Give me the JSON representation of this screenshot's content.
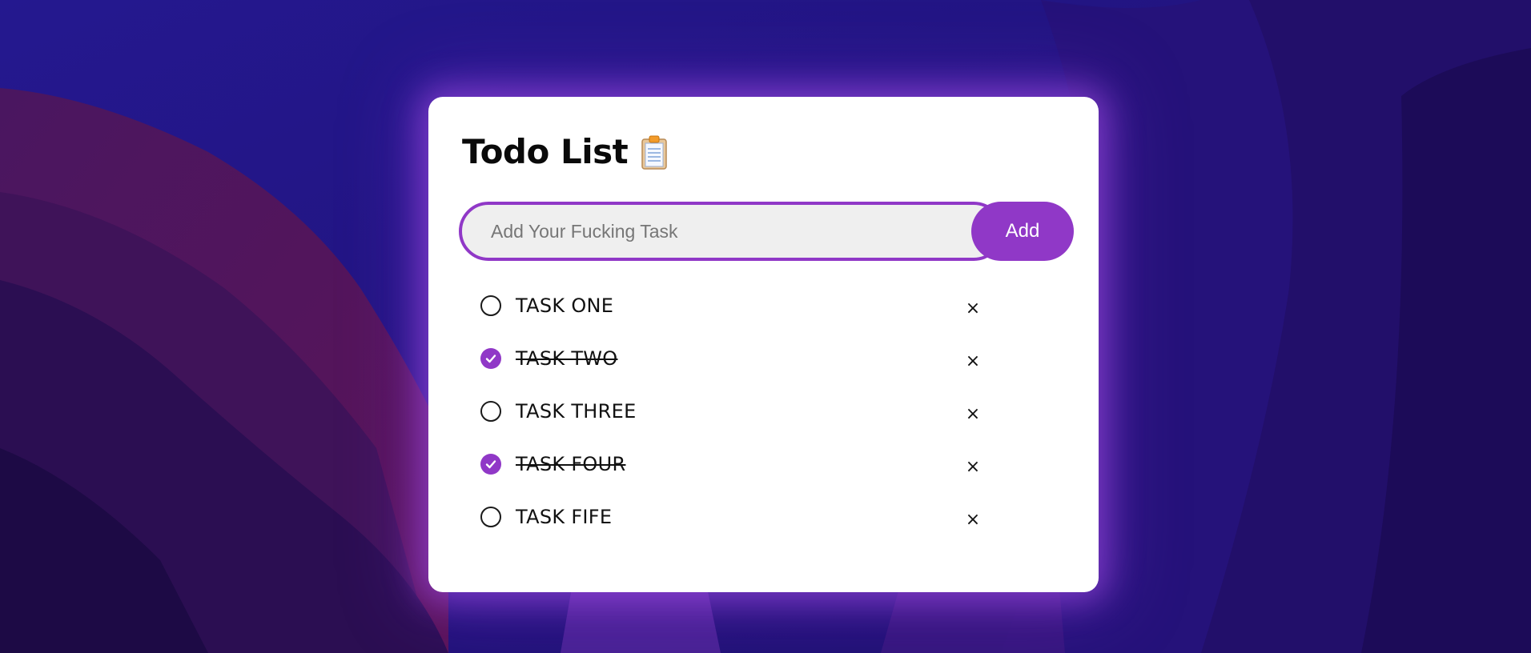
{
  "app": {
    "title": "Todo List",
    "title_icon": "clipboard-icon"
  },
  "form": {
    "placeholder": "Add Your Fucking Task",
    "add_label": "Add"
  },
  "tasks": [
    {
      "label": "TASK ONE",
      "done": false,
      "delete_label": "×"
    },
    {
      "label": "TASK TWO",
      "done": true,
      "delete_label": "×"
    },
    {
      "label": "TASK THREE",
      "done": false,
      "delete_label": "×"
    },
    {
      "label": "TASK FOUR",
      "done": true,
      "delete_label": "×"
    },
    {
      "label": "TASK FIFE",
      "done": false,
      "delete_label": "×"
    }
  ],
  "colors": {
    "accent": "#9038c7",
    "card": "#ffffff",
    "input_bg": "#efefef",
    "background": "#231386"
  }
}
